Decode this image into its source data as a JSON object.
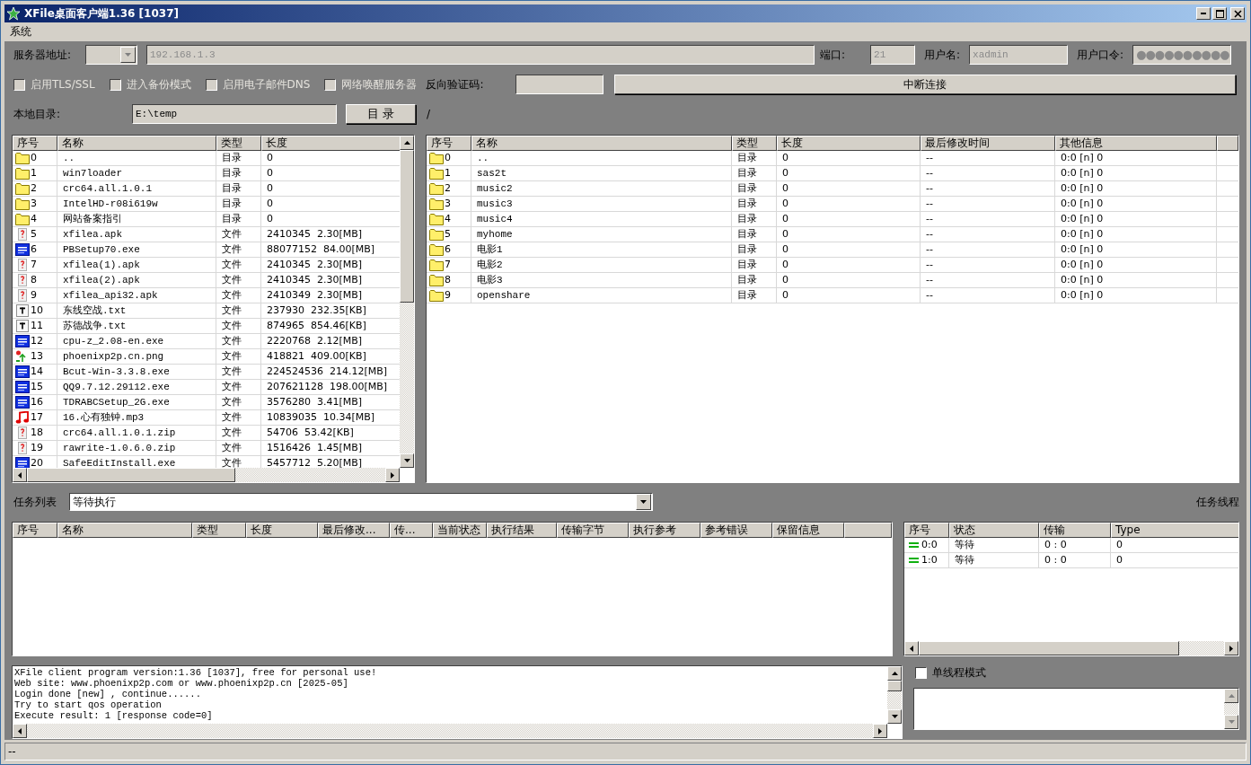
{
  "window": {
    "title": "XFile桌面客户端1.36 [1037]"
  },
  "menu": [
    {
      "label": "系统"
    }
  ],
  "connection": {
    "disabled": true,
    "server_label": "服务器地址:",
    "host": "192.168.1.3",
    "port_label": "端口:",
    "port": "21",
    "user_label": "用户名:",
    "user": "xadmin",
    "password_label": "用户口令:",
    "password": "●●●●●●●●●●"
  },
  "options": [
    {
      "label": "启用TLS/SSL",
      "checked": false,
      "disabled": true
    },
    {
      "label": "进入备份模式",
      "checked": false,
      "disabled": true
    },
    {
      "label": "启用电子邮件DNS",
      "checked": false,
      "disabled": true
    },
    {
      "label": "网络唤醒服务器",
      "checked": false,
      "disabled": true
    }
  ],
  "reverse_code_label": "反向验证码:",
  "disconnect_button": "中断连接",
  "local_dir": {
    "label": "本地目录:",
    "value": "E:\\temp",
    "button": "目 录",
    "remote_path": "/"
  },
  "local_files": {
    "columns": [
      "序号",
      "名称",
      "类型",
      "长度"
    ],
    "rows": [
      {
        "kind": "folder",
        "no": "0",
        "name": "..",
        "type": "目录",
        "size": "0"
      },
      {
        "kind": "folder",
        "no": "1",
        "name": "win7loader",
        "type": "目录",
        "size": "0"
      },
      {
        "kind": "folder",
        "no": "2",
        "name": "crc64.all.1.0.1",
        "type": "目录",
        "size": "0"
      },
      {
        "kind": "folder",
        "no": "3",
        "name": "IntelHD-r08i619w",
        "type": "目录",
        "size": "0"
      },
      {
        "kind": "folder",
        "no": "4",
        "name": "网站备案指引",
        "type": "目录",
        "size": "0"
      },
      {
        "kind": "unknown",
        "no": "5",
        "name": "xfilea.apk",
        "type": "文件",
        "size": "2410345  2.30[MB]"
      },
      {
        "kind": "exe",
        "no": "6",
        "name": "PBSetup70.exe",
        "type": "文件",
        "size": "88077152  84.00[MB]"
      },
      {
        "kind": "unknown",
        "no": "7",
        "name": "xfilea(1).apk",
        "type": "文件",
        "size": "2410345  2.30[MB]"
      },
      {
        "kind": "unknown",
        "no": "8",
        "name": "xfilea(2).apk",
        "type": "文件",
        "size": "2410345  2.30[MB]"
      },
      {
        "kind": "unknown",
        "no": "9",
        "name": "xfilea_api32.apk",
        "type": "文件",
        "size": "2410349  2.30[MB]"
      },
      {
        "kind": "text",
        "no": "10",
        "name": "东线空战.txt",
        "type": "文件",
        "size": "237930  232.35[KB]"
      },
      {
        "kind": "text",
        "no": "11",
        "name": "苏德战争.txt",
        "type": "文件",
        "size": "874965  854.46[KB]"
      },
      {
        "kind": "exe",
        "no": "12",
        "name": "cpu-z_2.08-en.exe",
        "type": "文件",
        "size": "2220768  2.12[MB]"
      },
      {
        "kind": "image",
        "no": "13",
        "name": "phoenixp2p.cn.png",
        "type": "文件",
        "size": "418821  409.00[KB]"
      },
      {
        "kind": "exe",
        "no": "14",
        "name": "Bcut-Win-3.3.8.exe",
        "type": "文件",
        "size": "224524536  214.12[MB]"
      },
      {
        "kind": "exe",
        "no": "15",
        "name": "QQ9.7.12.29112.exe",
        "type": "文件",
        "size": "207621128  198.00[MB]"
      },
      {
        "kind": "exe",
        "no": "16",
        "name": "TDRABCSetup_2G.exe",
        "type": "文件",
        "size": "3576280  3.41[MB]"
      },
      {
        "kind": "audio",
        "no": "17",
        "name": "16.心有独钟.mp3",
        "type": "文件",
        "size": "10839035  10.34[MB]"
      },
      {
        "kind": "unknown",
        "no": "18",
        "name": "crc64.all.1.0.1.zip",
        "type": "文件",
        "size": "54706  53.42[KB]"
      },
      {
        "kind": "unknown",
        "no": "19",
        "name": "rawrite-1.0.6.0.zip",
        "type": "文件",
        "size": "1516426  1.45[MB]"
      },
      {
        "kind": "exe",
        "no": "20",
        "name": "SafeEditInstall.exe",
        "type": "文件",
        "size": "5457712  5.20[MB]"
      }
    ]
  },
  "remote_files": {
    "columns": [
      "序号",
      "名称",
      "类型",
      "长度",
      "最后修改时间",
      "其他信息"
    ],
    "rows": [
      {
        "kind": "folder",
        "no": "0",
        "name": "..",
        "type": "目录",
        "size": "0",
        "modified": "--",
        "info": "0:0 [n] 0"
      },
      {
        "kind": "folder",
        "no": "1",
        "name": "sas2t",
        "type": "目录",
        "size": "0",
        "modified": "--",
        "info": "0:0 [n] 0"
      },
      {
        "kind": "folder",
        "no": "2",
        "name": "music2",
        "type": "目录",
        "size": "0",
        "modified": "--",
        "info": "0:0 [n] 0"
      },
      {
        "kind": "folder",
        "no": "3",
        "name": "music3",
        "type": "目录",
        "size": "0",
        "modified": "--",
        "info": "0:0 [n] 0"
      },
      {
        "kind": "folder",
        "no": "4",
        "name": "music4",
        "type": "目录",
        "size": "0",
        "modified": "--",
        "info": "0:0 [n] 0"
      },
      {
        "kind": "folder",
        "no": "5",
        "name": "myhome",
        "type": "目录",
        "size": "0",
        "modified": "--",
        "info": "0:0 [n] 0"
      },
      {
        "kind": "folder",
        "no": "6",
        "name": "电影1",
        "type": "目录",
        "size": "0",
        "modified": "--",
        "info": "0:0 [n] 0"
      },
      {
        "kind": "folder",
        "no": "7",
        "name": "电影2",
        "type": "目录",
        "size": "0",
        "modified": "--",
        "info": "0:0 [n] 0"
      },
      {
        "kind": "folder",
        "no": "8",
        "name": "电影3",
        "type": "目录",
        "size": "0",
        "modified": "--",
        "info": "0:0 [n] 0"
      },
      {
        "kind": "folder",
        "no": "9",
        "name": "openshare",
        "type": "目录",
        "size": "0",
        "modified": "--",
        "info": "0:0 [n] 0"
      }
    ]
  },
  "task_list": {
    "label": "任务列表",
    "filter": "等待执行",
    "columns": [
      "序号",
      "名称",
      "类型",
      "长度",
      "最后修改...",
      "传...",
      "当前状态",
      "执行结果",
      "传输字节",
      "执行参考",
      "参考错误",
      "保留信息"
    ]
  },
  "thread_label": "任务线程",
  "threads": {
    "columns": [
      "序号",
      "状态",
      "传输",
      "Type"
    ],
    "rows": [
      {
        "no": "0:0",
        "status": "等待",
        "transfer": "0 : 0",
        "type": "0"
      },
      {
        "no": "1:0",
        "status": "等待",
        "transfer": "0 : 0",
        "type": "0"
      }
    ]
  },
  "log": {
    "lines": [
      "XFile client program version:1.36 [1037], free for personal use!",
      "Web site: www.phoenixp2p.com or www.phoenixp2p.cn [2025-05]",
      "Login done [new] , continue......",
      "Try to start qos operation",
      "Execute result: 1 [response code=0]"
    ]
  },
  "single_thread": {
    "label": "单线程模式",
    "checked": false
  },
  "status_bar": "--"
}
